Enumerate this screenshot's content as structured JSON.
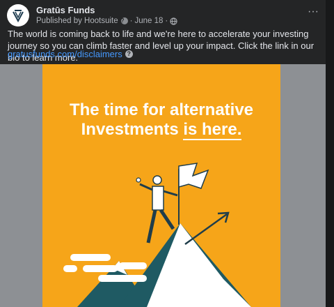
{
  "post": {
    "page_name": "Gratūs Funds",
    "meta": {
      "published_by": "Published by Hootsuite",
      "date": "June 18",
      "info_icon": "question-icon",
      "privacy_icon": "globe-icon"
    },
    "more_icon": "more-options-icon",
    "more_label": "···",
    "body_text": "The world is coming back to life and we're here to accelerate your investing journey so you can climb faster and level up your impact. Click the link in our bio to learn more.",
    "link_text": "gratusfunds.com/disclaimers",
    "image": {
      "headline_line1": "The time for alternative",
      "headline_line2_start": "Investments ",
      "headline_line2_underlined": "is here.",
      "background_color": "#f6a519",
      "side_color": "#8d9094"
    }
  }
}
